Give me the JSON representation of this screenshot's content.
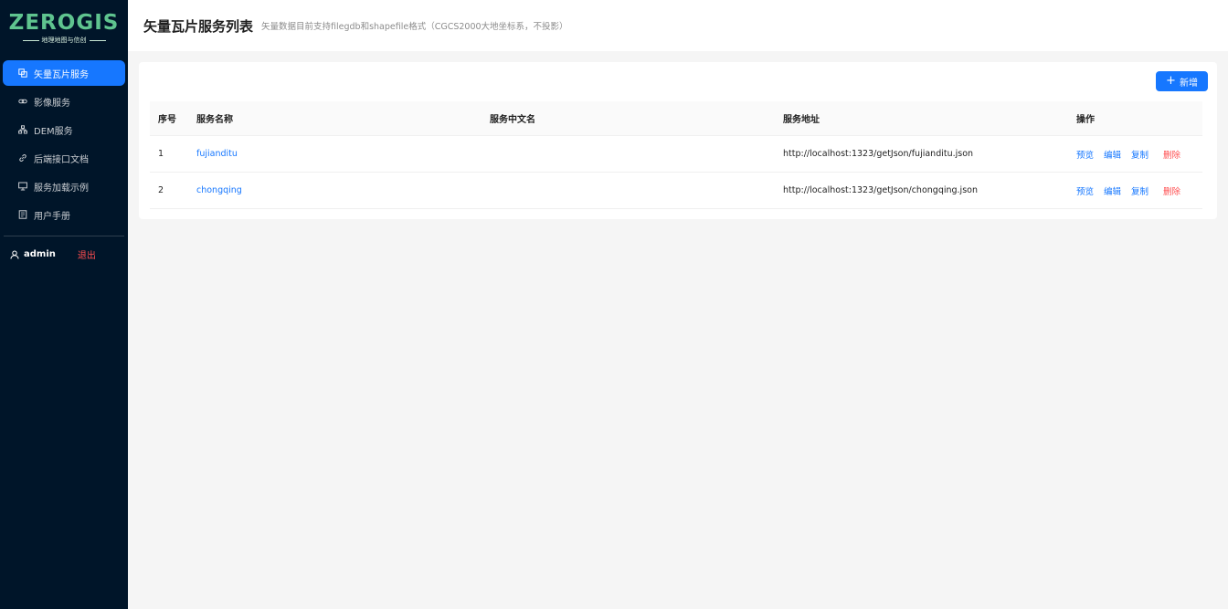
{
  "brand": {
    "title": "ZEROGIS",
    "subtitle": "地理地图与信创",
    "accent": "#5fc48f"
  },
  "sidebar": {
    "items": [
      {
        "label": "矢量瓦片服务",
        "icon": "copy-icon",
        "active": true
      },
      {
        "label": "影像服务",
        "icon": "link-icon",
        "active": false
      },
      {
        "label": "DEM服务",
        "icon": "cluster-icon",
        "active": false
      },
      {
        "label": "后端接口文档",
        "icon": "link-icon",
        "active": false
      },
      {
        "label": "服务加载示例",
        "icon": "desktop-icon",
        "active": false
      },
      {
        "label": "用户手册",
        "icon": "book-icon",
        "active": false
      }
    ],
    "user": {
      "name": "admin",
      "logout": "退出"
    }
  },
  "header": {
    "title": "矢量瓦片服务列表",
    "subtitle": "矢量数据目前支持filegdb和shapefile格式（CGCS2000大地坐标系，不投影）"
  },
  "toolbar": {
    "add_label": "新增"
  },
  "table": {
    "columns": [
      "序号",
      "服务名称",
      "服务中文名",
      "服务地址",
      "操作"
    ],
    "rows": [
      {
        "index": "1",
        "name": "fujianditu",
        "cn_name": "",
        "url": "http://localhost:1323/getJson/fujianditu.json"
      },
      {
        "index": "2",
        "name": "chongqing",
        "cn_name": "",
        "url": "http://localhost:1323/getJson/chongqing.json"
      }
    ],
    "actions": {
      "preview": "预览",
      "edit": "编辑",
      "copy": "复制",
      "delete": "删除"
    }
  },
  "colors": {
    "sidebar_bg": "#001529",
    "primary": "#1677ff",
    "danger": "#ff4d4f"
  }
}
